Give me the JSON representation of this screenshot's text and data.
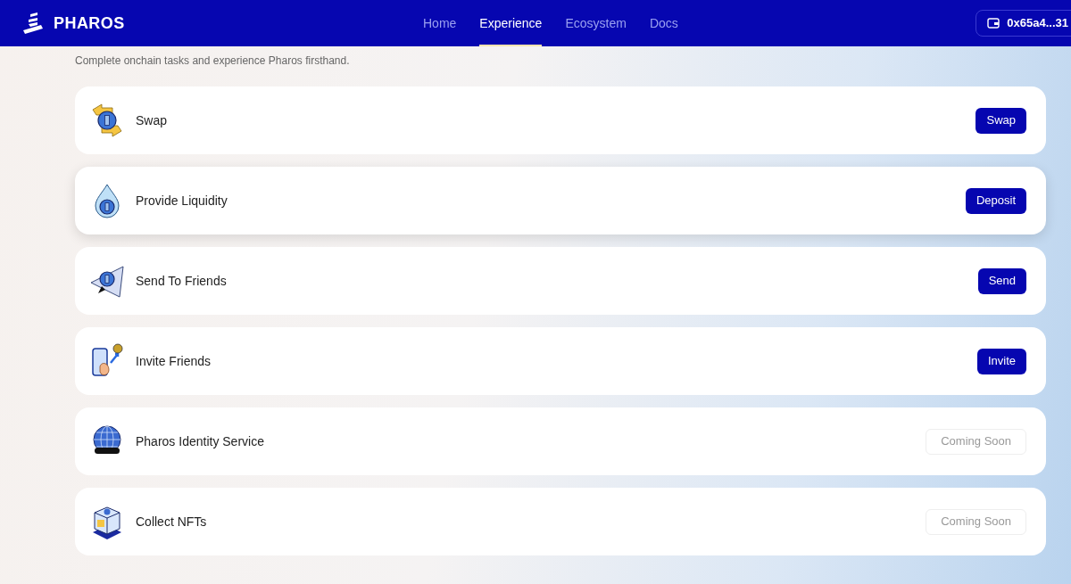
{
  "header": {
    "brand": "PHAROS",
    "nav": [
      {
        "label": "Home",
        "selected": false
      },
      {
        "label": "Experience",
        "selected": true
      },
      {
        "label": "Ecosystem",
        "selected": false
      },
      {
        "label": "Docs",
        "selected": false
      }
    ],
    "wallet": "0x65a4...31"
  },
  "subtitle": "Complete onchain tasks and experience Pharos firsthand.",
  "tasks": [
    {
      "kind": "swap",
      "title": "Swap",
      "action": "Swap",
      "disabled": false,
      "raised": false
    },
    {
      "kind": "liquidity",
      "title": "Provide Liquidity",
      "action": "Deposit",
      "disabled": false,
      "raised": true
    },
    {
      "kind": "send",
      "title": "Send To Friends",
      "action": "Send",
      "disabled": false,
      "raised": false
    },
    {
      "kind": "invite",
      "title": "Invite Friends",
      "action": "Invite",
      "disabled": false,
      "raised": false
    },
    {
      "kind": "identity",
      "title": "Pharos Identity Service",
      "action": "Coming Soon",
      "disabled": true,
      "raised": false
    },
    {
      "kind": "nft",
      "title": "Collect NFTs",
      "action": "Coming Soon",
      "disabled": true,
      "raised": false
    }
  ]
}
